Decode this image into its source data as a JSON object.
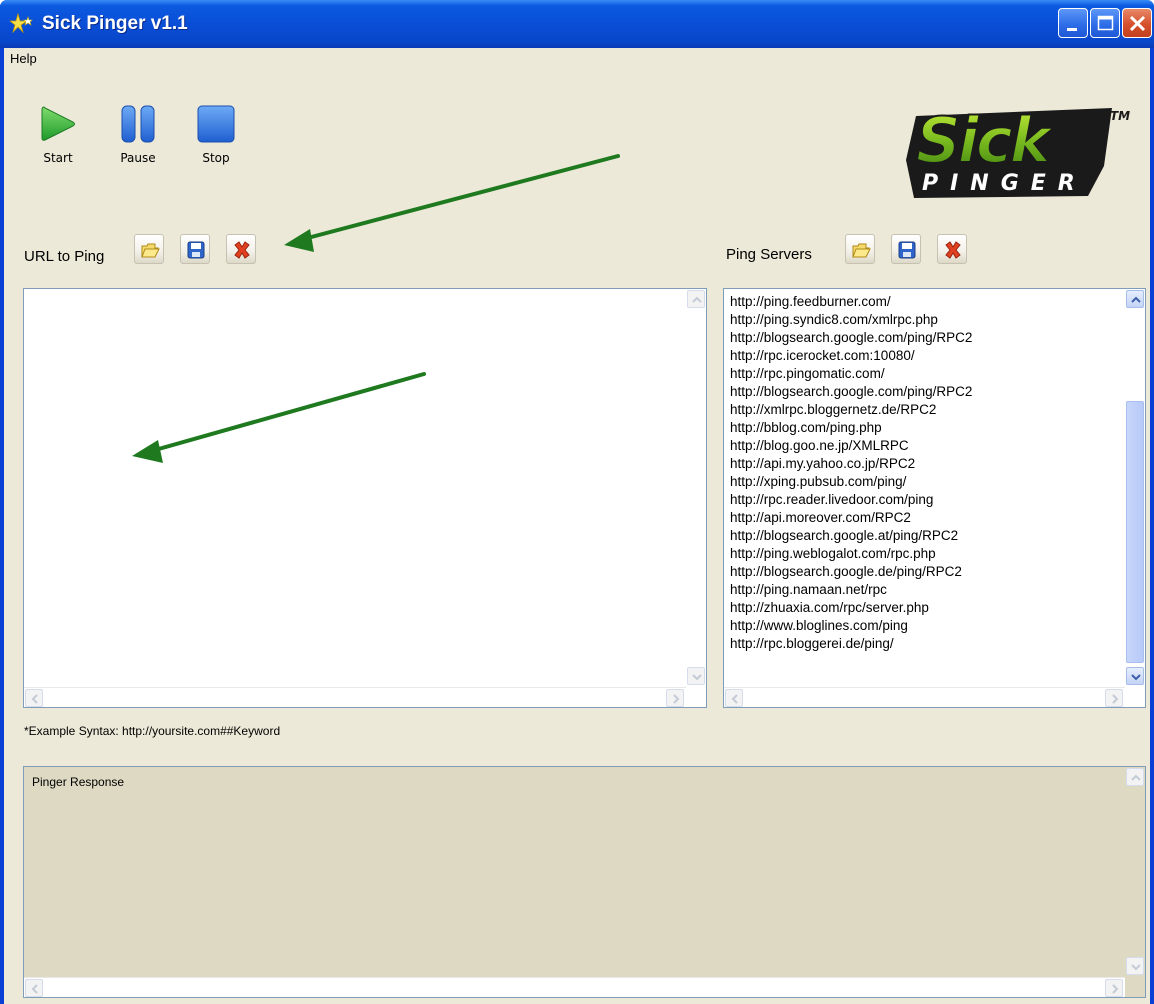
{
  "window": {
    "title": "Sick Pinger v1.1",
    "buttons": [
      "minimize-icon",
      "maximize-icon",
      "close-icon"
    ]
  },
  "menu": {
    "items": [
      {
        "label": "Help"
      }
    ]
  },
  "toolbar": {
    "start_label": "Start",
    "pause_label": "Pause",
    "stop_label": "Stop"
  },
  "logo": {
    "word": "Sick",
    "sub": "PINGER",
    "tm": "TM"
  },
  "url_panel": {
    "label": "URL to Ping",
    "buttons": [
      "open-folder-icon",
      "save-disk-icon",
      "delete-x-icon"
    ],
    "content": "",
    "hint": "*Example Syntax: http://yoursite.com##Keyword"
  },
  "servers_panel": {
    "label": "Ping Servers",
    "buttons": [
      "open-folder-icon",
      "save-disk-icon",
      "delete-x-icon"
    ],
    "servers": [
      "http://ping.feedburner.com/",
      "http://ping.syndic8.com/xmlrpc.php",
      "http://blogsearch.google.com/ping/RPC2",
      "http://rpc.icerocket.com:10080/",
      "http://rpc.pingomatic.com/",
      "http://blogsearch.google.com/ping/RPC2",
      "http://xmlrpc.bloggernetz.de/RPC2",
      "http://bblog.com/ping.php",
      "http://blog.goo.ne.jp/XMLRPC",
      "http://api.my.yahoo.co.jp/RPC2",
      "http://xping.pubsub.com/ping/",
      "http://rpc.reader.livedoor.com/ping",
      "http://api.moreover.com/RPC2",
      "http://blogsearch.google.at/ping/RPC2",
      "http://ping.weblogalot.com/rpc.php",
      "http://blogsearch.google.de/ping/RPC2",
      "http://ping.namaan.net/rpc",
      "http://zhuaxia.com/rpc/server.php",
      "http://www.bloglines.com/ping",
      "http://rpc.bloggerei.de/ping/"
    ]
  },
  "response_panel": {
    "label": "Pinger Response"
  },
  "colors": {
    "titlebar": "#0a4ed7",
    "window_bg": "#ece9d8",
    "response_bg": "#ded9c2",
    "arrow": "#1f7a1f",
    "play": "#3cb043",
    "pause_stop": "#2a73d8"
  }
}
